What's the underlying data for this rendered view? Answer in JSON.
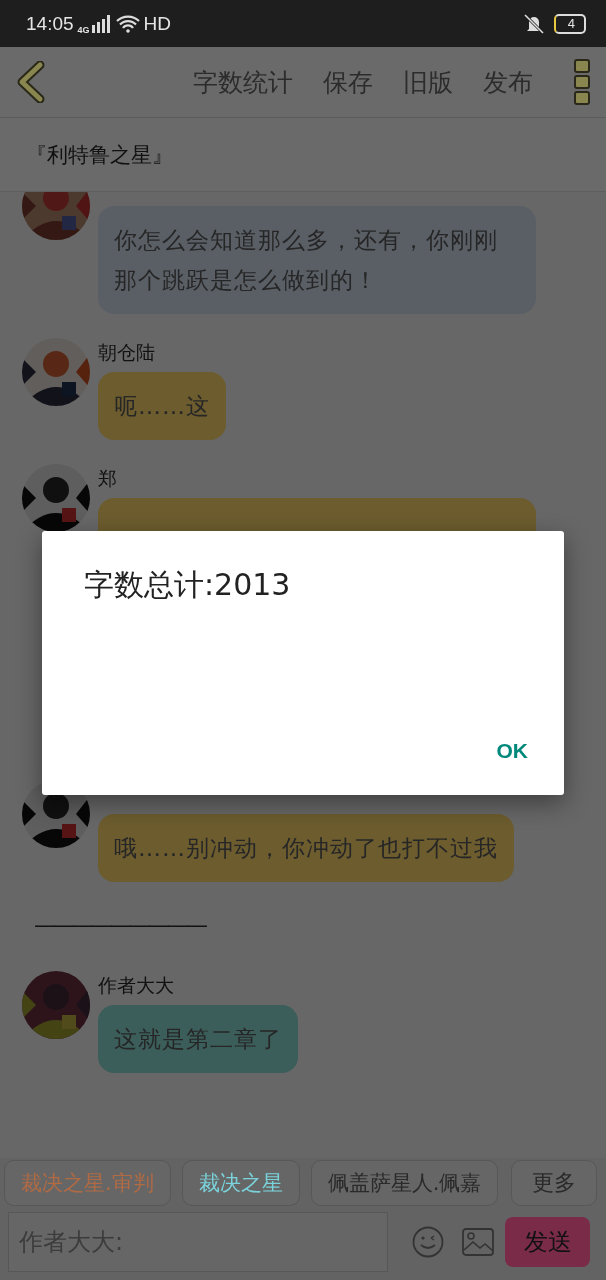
{
  "status_bar": {
    "time": "14:05",
    "network": "4G",
    "hd": "HD",
    "battery": "4"
  },
  "header": {
    "actions": [
      "字数统计",
      "保存",
      "旧版",
      "发布"
    ]
  },
  "title": "『利特鲁之星』",
  "messages": [
    {
      "kind": "message",
      "text": "你怎么会知道那么多，还有，你刚刚那个跳跃是怎么做到的！",
      "color": "#5a5f66"
    },
    {
      "kind": "message",
      "name": "朝仓陆",
      "text": "呃……这",
      "color": "#6c5c2e"
    },
    {
      "kind": "message",
      "name": "郑",
      "color": "#6c5c2e"
    },
    {
      "kind": "message",
      "text": "哦……别冲动，你冲动了也打不过我",
      "color": "#6c5c2e"
    },
    {
      "kind": "separator",
      "text": "—————————"
    },
    {
      "kind": "message",
      "name": "作者大大",
      "text": "这就是第二章了",
      "color": "#3b5e5b"
    }
  ],
  "chips": [
    {
      "label": "裁决之星.审判",
      "color": "#b06a44"
    },
    {
      "label": "裁决之星",
      "color": "#7ad2da"
    },
    {
      "label": "佩盖萨星人.佩嘉",
      "color": "#2a2a2a"
    }
  ],
  "compose": {
    "more": "更多",
    "placeholder": "作者大大:",
    "send": "发送"
  },
  "dialog": {
    "message": "字数总计:2013",
    "button": "OK"
  }
}
